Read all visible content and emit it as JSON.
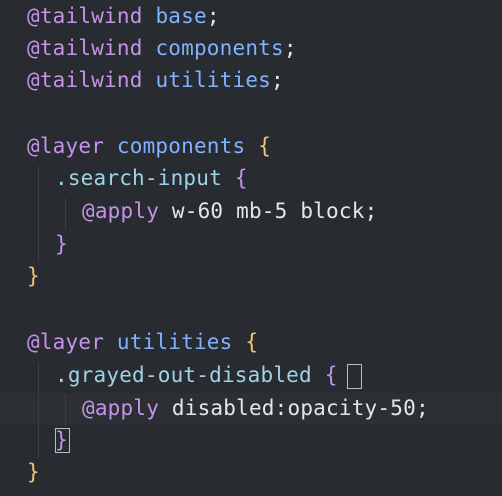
{
  "lines": [
    {
      "directive": "@tailwind",
      "value": "base",
      "end": ";"
    },
    {
      "directive": "@tailwind",
      "value": "components",
      "end": ";"
    },
    {
      "directive": "@tailwind",
      "value": "utilities",
      "end": ";"
    },
    {
      "directive": "@layer",
      "value": "components",
      "open": "{"
    },
    {
      "selector": ".search-input",
      "open": "{"
    },
    {
      "directive": "@apply",
      "value": "w-60 mb-5 block",
      "end": ";"
    },
    {
      "close": "}"
    },
    {
      "close": "}"
    },
    {
      "directive": "@layer",
      "value": "utilities",
      "open": "{"
    },
    {
      "selector": ".grayed-out-disabled",
      "open": "{"
    },
    {
      "directive": "@apply",
      "value": "disabled:opacity-50",
      "end": ";"
    },
    {
      "close": "}"
    },
    {
      "close": "}"
    }
  ],
  "colors": {
    "background": "#282b2f",
    "directive": "#c792ea",
    "identifier": "#82b1ff",
    "selector": "#9fd3e8",
    "outer_brace": "#f0c674",
    "text": "#e6e6e6"
  }
}
